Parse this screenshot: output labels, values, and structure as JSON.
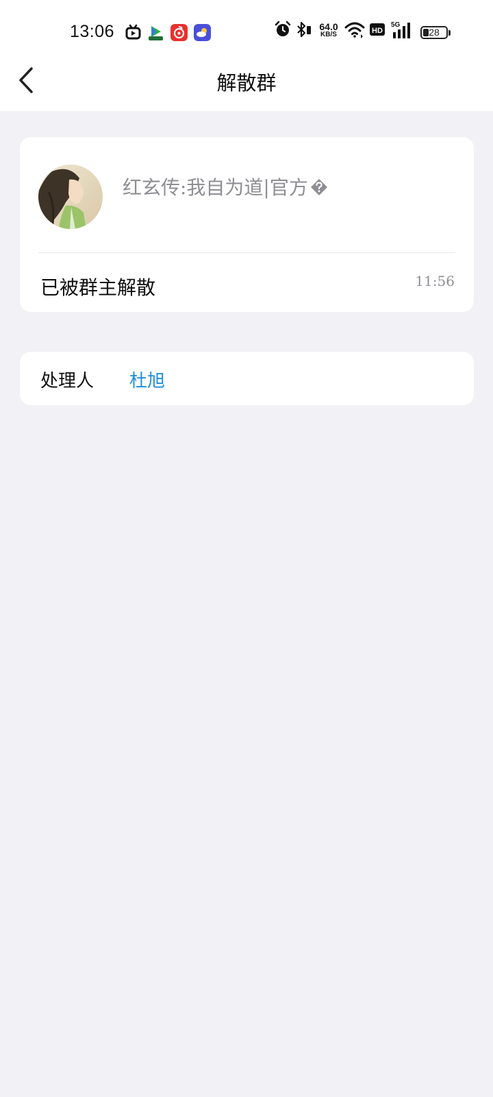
{
  "status_bar": {
    "time": "13:06",
    "speed_value": "64.0",
    "speed_unit": "KB/S",
    "battery": "28",
    "icons": [
      "tv-app-icon",
      "video-app-icon",
      "music-app-icon",
      "weather-app-icon",
      "alarm-icon",
      "bluetooth-icon",
      "wifi-icon",
      "hd-icon",
      "5g-signal-icon",
      "battery-icon"
    ]
  },
  "header": {
    "title": "解散群",
    "back_icon": "chevron-left-icon"
  },
  "group_card": {
    "group_name": "红玄传:我自为道|官方",
    "event_text": "已被群主解散",
    "event_time": "11:56"
  },
  "handler_card": {
    "label": "处理人",
    "name": "杜旭"
  },
  "colors": {
    "background": "#f1f1f6",
    "card": "#ffffff",
    "accent": "#1e8ee0",
    "secondary_text": "#8e8e93"
  }
}
